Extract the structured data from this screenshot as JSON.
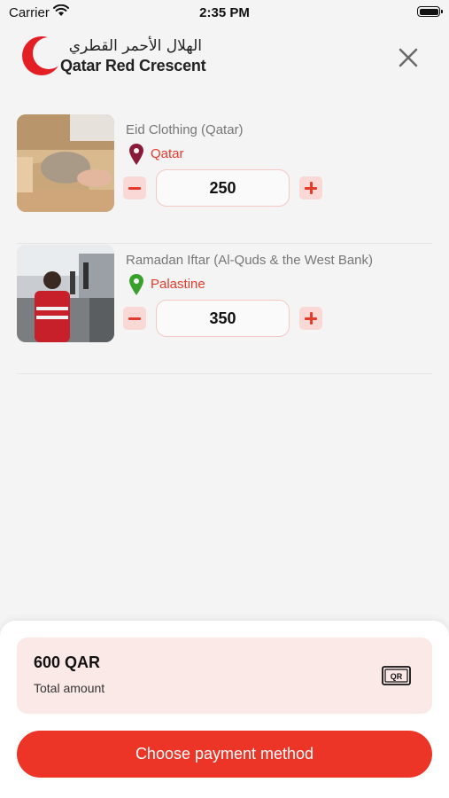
{
  "status_bar": {
    "carrier": "Carrier",
    "time": "2:35 PM"
  },
  "header": {
    "logo_arabic": "الهلال الأحمر القطري",
    "logo_english": "Qatar Red Crescent"
  },
  "items": [
    {
      "title": "Eid Clothing (Qatar)",
      "location": "Qatar",
      "pin_color": "#8b1a3a",
      "quantity": "250"
    },
    {
      "title": "Ramadan Iftar (Al-Quds & the West Bank)",
      "location": "Palastine",
      "pin_color": "#3aa02c",
      "quantity": "350"
    }
  ],
  "summary": {
    "total_amount": "600 QAR",
    "total_label": "Total amount",
    "currency_icon_text": "QR"
  },
  "actions": {
    "pay_label": "Choose payment method"
  },
  "colors": {
    "accent": "#ec3527",
    "light_accent": "#f9d8d5"
  }
}
